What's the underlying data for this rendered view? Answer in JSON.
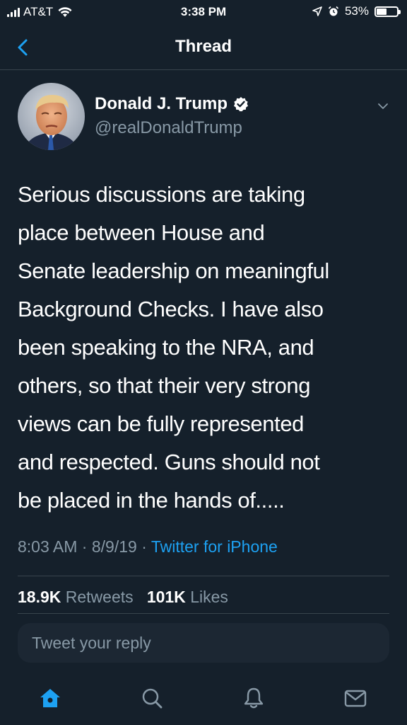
{
  "status_bar": {
    "carrier": "AT&T",
    "time": "3:38 PM",
    "battery": "53%",
    "battery_level": 0.53
  },
  "nav": {
    "title": "Thread"
  },
  "tweet": {
    "author_name": "Donald J. Trump",
    "author_handle": "@realDonaldTrump",
    "text": "Serious discussions are taking\nplace between House and\nSenate leadership  on meaningful\nBackground Checks. I have also\nbeen speaking to the NRA, and\nothers, so that their very strong\nviews can be fully represented\nand respected. Guns should not\nbe placed in the hands of.....",
    "time": "8:03 AM",
    "date": "8/9/19",
    "separator": "·",
    "source": "Twitter for iPhone",
    "retweets_count": "18.9K",
    "retweets_label": "Retweets",
    "likes_count": "101K",
    "likes_label": "Likes"
  },
  "reply": {
    "placeholder": "Tweet your reply"
  },
  "tab_bar": {
    "items": [
      "home-icon",
      "search-icon",
      "notifications-icon",
      "messages-icon"
    ],
    "active": "home-icon"
  },
  "colors": {
    "background": "#15202b",
    "accent": "#1da1f2",
    "secondary_text": "#8899a6",
    "divider": "#38444d"
  }
}
